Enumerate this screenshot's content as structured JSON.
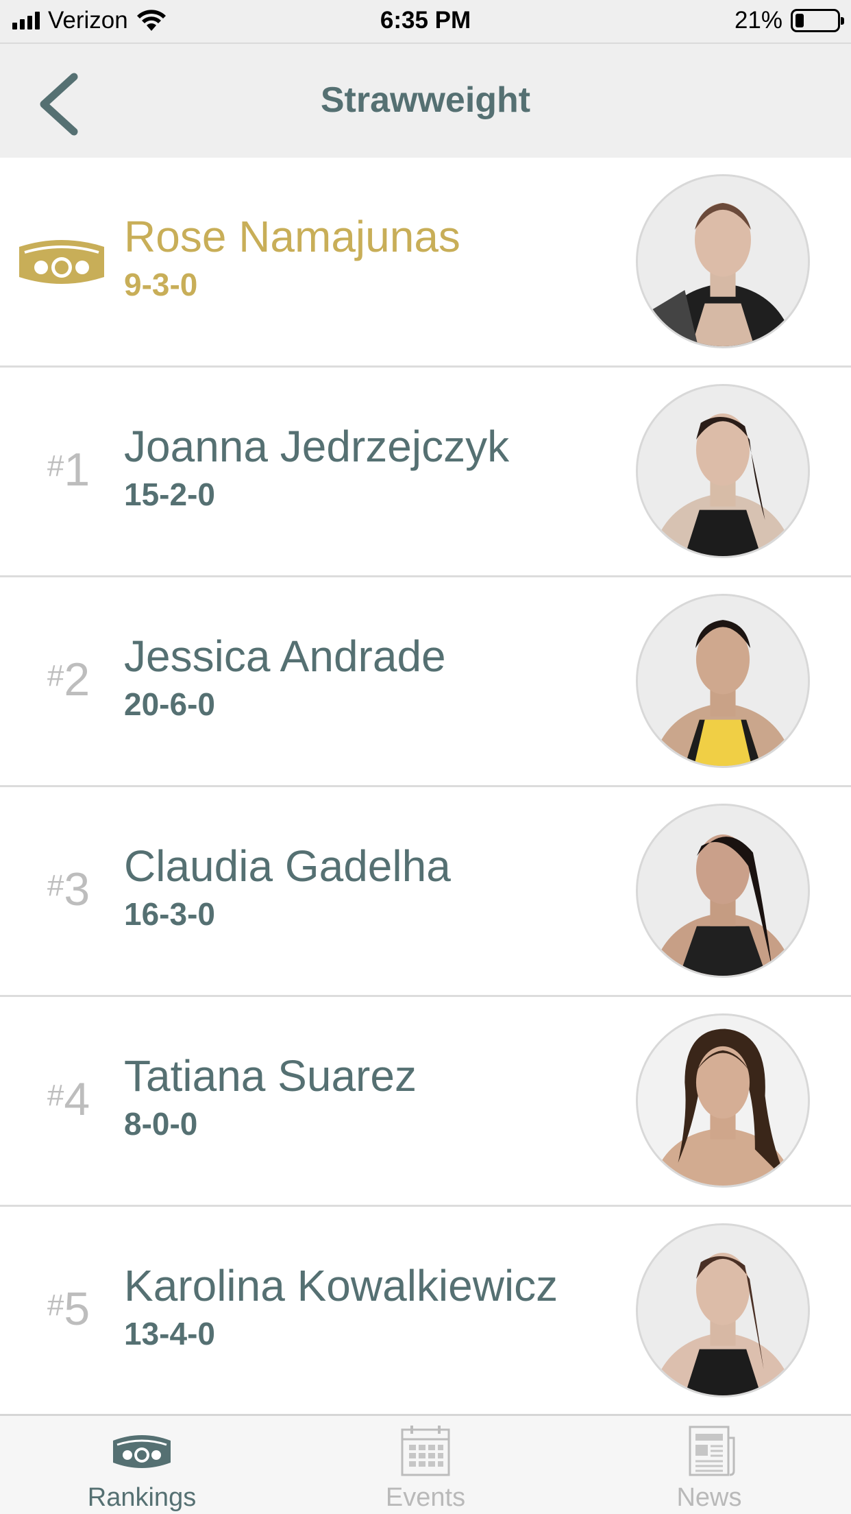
{
  "status_bar": {
    "carrier": "Verizon",
    "time": "6:35 PM",
    "battery": "21%",
    "battery_level": 0.21,
    "icons": [
      "signal-icon",
      "wifi-icon",
      "battery-icon"
    ]
  },
  "nav": {
    "title": "Strawweight",
    "back_icon": "chevron-left-icon"
  },
  "colors": {
    "accent": "#557072",
    "champion_gold": "#c8ae58",
    "rank_gray": "#bdbdbd",
    "divider": "#dcdcdc",
    "bar_bg": "#efefef"
  },
  "rankings": [
    {
      "rank": "",
      "champion": true,
      "name": "Rose Namajunas",
      "record": "9-3-0",
      "icon": "championship-belt-icon"
    },
    {
      "rank_hash": "#",
      "rank": "1",
      "champion": false,
      "name": "Joanna Jedrzejczyk",
      "record": "15-2-0"
    },
    {
      "rank_hash": "#",
      "rank": "2",
      "champion": false,
      "name": "Jessica Andrade",
      "record": "20-6-0"
    },
    {
      "rank_hash": "#",
      "rank": "3",
      "champion": false,
      "name": "Claudia Gadelha",
      "record": "16-3-0"
    },
    {
      "rank_hash": "#",
      "rank": "4",
      "champion": false,
      "name": "Tatiana Suarez",
      "record": "8-0-0"
    },
    {
      "rank_hash": "#",
      "rank": "5",
      "champion": false,
      "name": "Karolina Kowalkiewicz",
      "record": "13-4-0"
    }
  ],
  "tabs": [
    {
      "label": "Rankings",
      "icon": "belt-icon",
      "active": true
    },
    {
      "label": "Events",
      "icon": "calendar-icon",
      "active": false
    },
    {
      "label": "News",
      "icon": "newspaper-icon",
      "active": false
    }
  ]
}
